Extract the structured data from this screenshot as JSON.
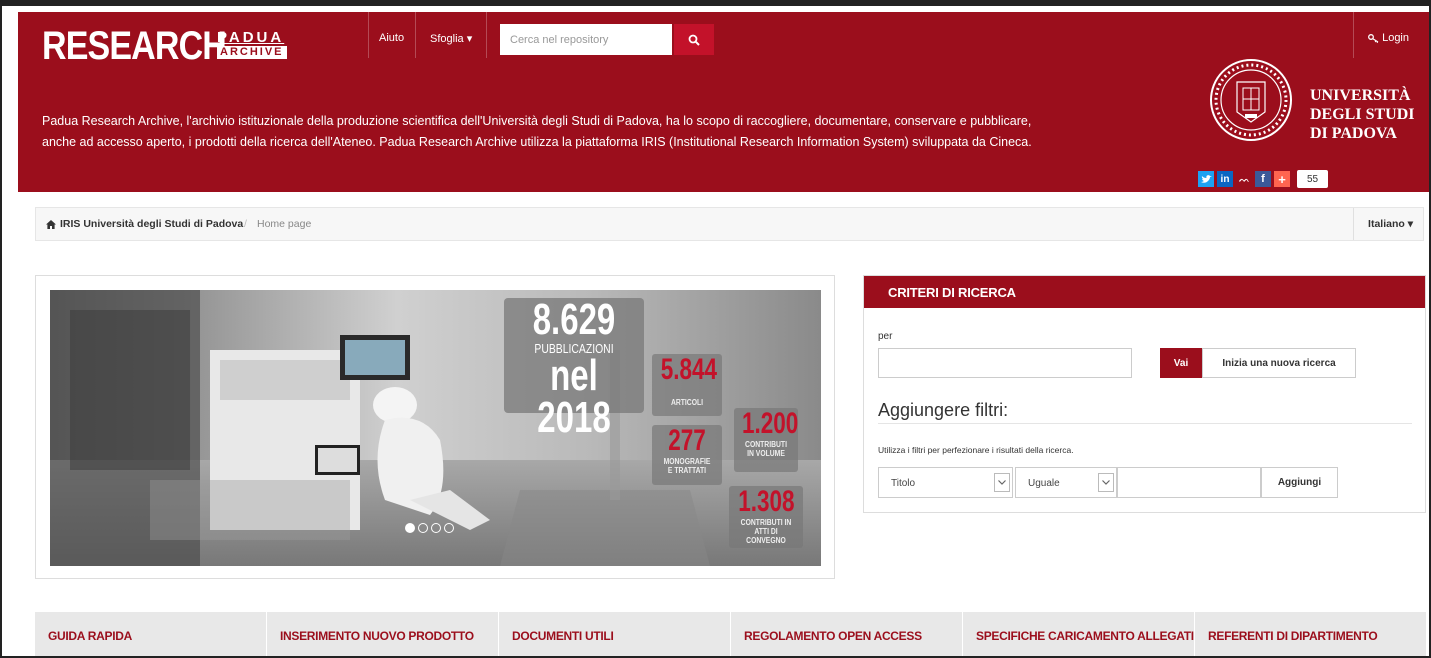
{
  "header": {
    "logo_main": "RESEARCH",
    "logo_padua": "PADUA",
    "logo_archive": "ARCHIVE",
    "nav": {
      "help": "Aiuto",
      "browse": "Sfoglia ▾"
    },
    "search": {
      "placeholder": "Cerca nel repository"
    },
    "login": "Login",
    "intro_line1": "Padua Research Archive, l'archivio istituzionale della produzione scientifica dell'Università degli Studi di Padova, ha lo scopo di raccogliere, documentare, conservare e pubblicare,",
    "intro_line2": "anche ad accesso aperto, i prodotti della ricerca dell'Ateneo. Padua Research Archive utilizza la piattaforma IRIS (Institutional Research Information System) sviluppata da Cineca.",
    "university": {
      "line1": "UNIVERSITÀ",
      "line2": "DEGLI STUDI",
      "line3": "DI PADOVA"
    },
    "social": {
      "count": "55",
      "icons": [
        "twitter-icon",
        "linkedin-icon",
        "mendeley-icon",
        "facebook-icon",
        "share-plus-icon"
      ]
    }
  },
  "breadcrumb": {
    "home": "IRIS Università degli Studi di Padova",
    "separator": "/",
    "current": "Home page",
    "language": "Italiano ▾"
  },
  "carousel": {
    "main_number": "8.629",
    "main_label": "PUBBLICAZIONI",
    "main_year": "nel 2018",
    "articles": {
      "value": "5.844",
      "label": "ARTICOLI"
    },
    "volumes": {
      "value": "1.200",
      "label1": "CONTRIBUTI",
      "label2": "IN VOLUME"
    },
    "monographs": {
      "value": "277",
      "label1": "MONOGRAFIE",
      "label2": "E TRATTATI"
    },
    "conference": {
      "value": "1.308",
      "label1": "CONTRIBUTI IN",
      "label2": "ATTI DI CONVEGNO"
    },
    "slides": 4,
    "active_slide": 1
  },
  "search_panel": {
    "title": "CRITERI DI RICERCA",
    "per_label": "per",
    "go": "Vai",
    "new_search": "Inizia una nuova ricerca",
    "filters_title": "Aggiungere filtri:",
    "filters_hint": "Utilizza i filtri per perfezionare i risultati della ricerca.",
    "field_select": "Titolo",
    "op_select": "Uguale",
    "add": "Aggiungi"
  },
  "tabs": [
    "GUIDA RAPIDA",
    "INSERIMENTO NUOVO PRODOTTO",
    "DOCUMENTI UTILI",
    "REGOLAMENTO OPEN ACCESS",
    "SPECIFICHE CARICAMENTO ALLEGATI",
    "REFERENTI DI DIPARTIMENTO"
  ],
  "colors": {
    "brand": "#9b0e1c",
    "accent": "#c3122a"
  }
}
